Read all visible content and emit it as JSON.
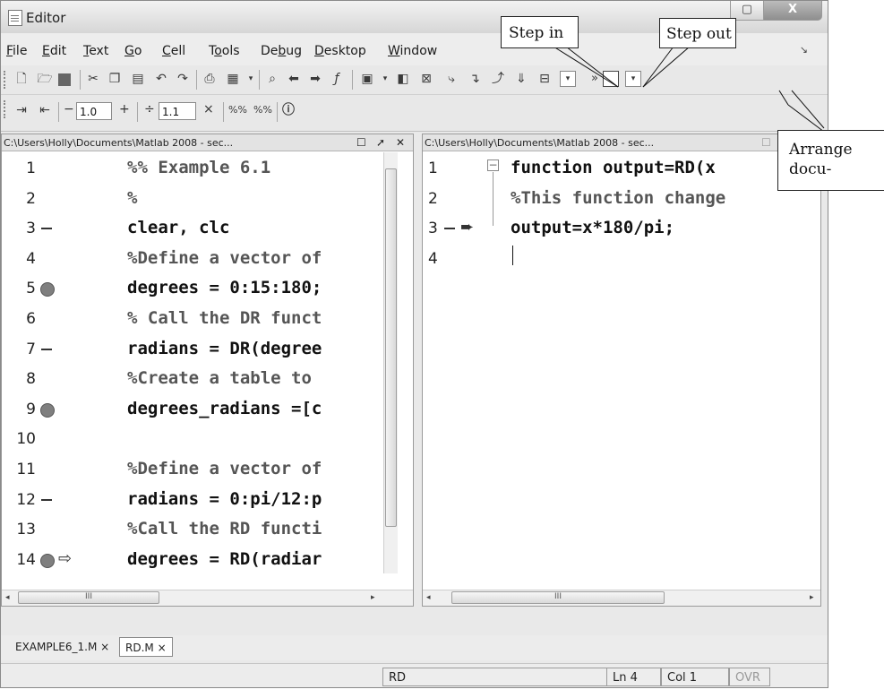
{
  "window": {
    "title": "Editor",
    "close_label": "X",
    "max_label": "▢"
  },
  "menus": [
    "File",
    "Edit",
    "Text",
    "Go",
    "Cell",
    "Tools",
    "Debug",
    "Desktop",
    "Window"
  ],
  "menu_mnemonics": [
    "F",
    "E",
    "T",
    "G",
    "C",
    "o",
    "b",
    "D",
    "W"
  ],
  "toolbar2": {
    "minus": "−",
    "value1": "1.0",
    "plus": "+",
    "divide": "÷",
    "value2": "1.1",
    "times": "×"
  },
  "left_pane": {
    "title": "C:\\Users\\Holly\\Documents\\Matlab 2008 - sec...",
    "lines": [
      {
        "n": "1",
        "marker": "",
        "code": "%% Example 6.1",
        "comment": true
      },
      {
        "n": "2",
        "marker": "",
        "code": "%",
        "comment": true
      },
      {
        "n": "3",
        "marker": "dash",
        "code": "clear, clc",
        "comment": false
      },
      {
        "n": "4",
        "marker": "",
        "code": "%Define a vector of",
        "comment": true
      },
      {
        "n": "5",
        "marker": "bp",
        "code": "degrees = 0:15:180;",
        "comment": false
      },
      {
        "n": "6",
        "marker": "",
        "code": "% Call the DR funct",
        "comment": true
      },
      {
        "n": "7",
        "marker": "dash",
        "code": "radians = DR(degree",
        "comment": false
      },
      {
        "n": "8",
        "marker": "",
        "code": "%Create a table to",
        "comment": true
      },
      {
        "n": "9",
        "marker": "bp",
        "code": "degrees_radians =[c",
        "comment": false
      },
      {
        "n": "10",
        "marker": "",
        "code": "",
        "comment": false
      },
      {
        "n": "11",
        "marker": "",
        "code": "%Define a vector of",
        "comment": true
      },
      {
        "n": "12",
        "marker": "dash",
        "code": "radians = 0:pi/12:p",
        "comment": false
      },
      {
        "n": "13",
        "marker": "",
        "code": "%Call the RD functi",
        "comment": true
      },
      {
        "n": "14",
        "marker": "bp-arrow",
        "code": "degrees = RD(radiar",
        "comment": false
      }
    ]
  },
  "right_pane": {
    "title": "C:\\Users\\Holly\\Documents\\Matlab 2008 - sec...",
    "lines": [
      {
        "n": "1",
        "code": "function output=RD(x",
        "comment": false
      },
      {
        "n": "2",
        "code": "%This function change",
        "comment": true
      },
      {
        "n": "3",
        "code": "output=x*180/pi;",
        "comment": false
      },
      {
        "n": "4",
        "code": "",
        "comment": false
      }
    ]
  },
  "scroll_marker": "III",
  "doc_tabs": [
    {
      "label": "EXAMPLE6_1.M",
      "active": false
    },
    {
      "label": "RD.M",
      "active": true
    }
  ],
  "status": {
    "function": "RD",
    "ln": "Ln  4",
    "col": "Col  1",
    "ovr": "OVR"
  },
  "callouts": {
    "step_in": "Step in",
    "step_out": "Step out",
    "arrange_line1": "Arrange",
    "arrange_line2": "docu-"
  }
}
